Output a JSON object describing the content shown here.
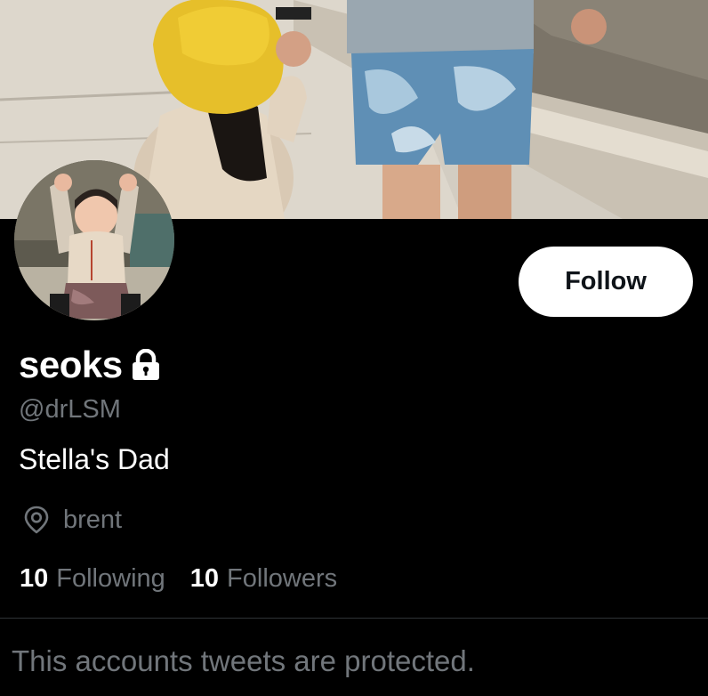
{
  "profile": {
    "display_name": "seoks",
    "handle": "@drLSM",
    "bio": "Stella's Dad",
    "location": "brent",
    "locked": true
  },
  "stats": {
    "following_count": "10",
    "following_label": "Following",
    "followers_count": "10",
    "followers_label": "Followers"
  },
  "actions": {
    "follow_label": "Follow"
  },
  "timeline": {
    "protected_message": "This accounts tweets are protected."
  },
  "icons": {
    "lock": "lock-icon",
    "location": "location-pin-icon"
  },
  "colors": {
    "background": "#000000",
    "primary_text": "#ffffff",
    "secondary_text": "#71767b",
    "button_bg": "#ffffff",
    "button_text": "#0f1419",
    "divider": "#2f3336"
  }
}
